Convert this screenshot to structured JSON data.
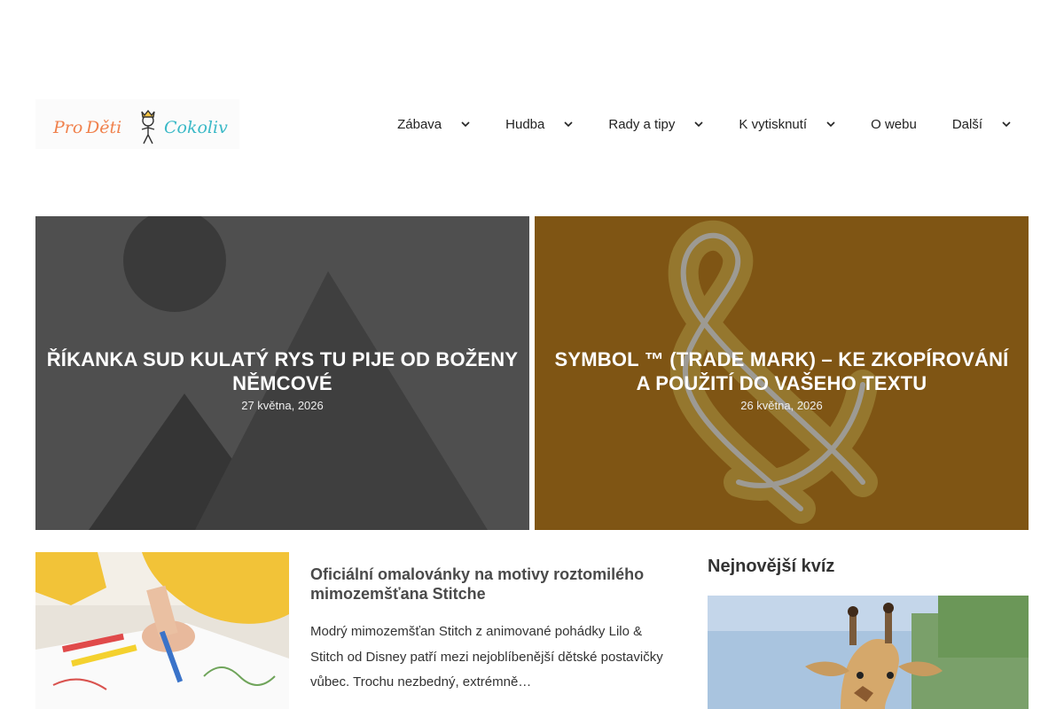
{
  "site": {
    "logo_text": "Pro Děti Cokoliv",
    "colors": {
      "logo_orange": "#f0814c",
      "logo_teal": "#3bb9c7",
      "accent": "#222222"
    }
  },
  "nav": {
    "items": [
      {
        "label": "Zábava",
        "has_dropdown": true,
        "icon": "chevron-down-icon"
      },
      {
        "label": "Hudba",
        "has_dropdown": true,
        "icon": "chevron-down-icon"
      },
      {
        "label": "Rady a tipy",
        "has_dropdown": true,
        "icon": "chevron-down-icon"
      },
      {
        "label": "K vytisknutí",
        "has_dropdown": true,
        "icon": "chevron-down-icon"
      },
      {
        "label": "O webu",
        "has_dropdown": false
      },
      {
        "label": "Další",
        "has_dropdown": true,
        "icon": "chevron-down-icon"
      }
    ]
  },
  "featured": [
    {
      "title": "Říkanka Sud kulatý rys tu pije od Boženy Němcové",
      "date": "27 května, 2026",
      "image": "image-placeholder-icon"
    },
    {
      "title": "Symbol ™ (trade mark) – ke zkopírování a použití do vašeho textu",
      "date": "26 května, 2026",
      "image": "ampersand-image"
    }
  ],
  "article": {
    "title": "Oficiální omalovánky na motivy roztomilého mimozemšťana Stitche",
    "excerpt": "Modrý mimozemšťan Stitch z animované pohádky Lilo & Stitch od Disney patří mezi nejoblíbenější dětské postavičky vůbec. Trochu nezbedný, extrémně…",
    "image": "child-coloring-photo"
  },
  "sidebar": {
    "heading": "Nejnovější kvíz",
    "image": "giraffe-photo"
  }
}
